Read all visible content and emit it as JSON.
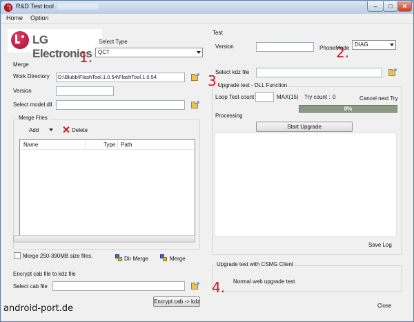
{
  "window": {
    "title": "R&D Test tool"
  },
  "menu": {
    "home": "Home",
    "option": "Option"
  },
  "logo": {
    "brand": "LG Electronics"
  },
  "select_type": {
    "label": "Select Type",
    "value": "QCT"
  },
  "merge": {
    "title": "Merge",
    "work_dir_label": "Work Directory",
    "work_dir_value": "D:\\Blubb\\FlashTool.1.0.54\\FlashTool.1.0.54",
    "version_label": "Version",
    "version_value": "",
    "model_dll_label": "Select model.dll",
    "model_dll_value": ""
  },
  "merge_files": {
    "title": "Merge Files",
    "add_label": "Add",
    "delete_label": "Delete",
    "columns": [
      "Name",
      "Type",
      "Path"
    ]
  },
  "merge_options": {
    "checkbox_label": "Merge 250-390MB size files.",
    "dir_merge_label": "Dir Merge",
    "merge_label": "Merge"
  },
  "encrypt": {
    "title": "Encrypt cab file to kdz file",
    "select_cab_label": "Select cab file",
    "select_cab_value": "",
    "button_label": "Encrypt cab -> kdz"
  },
  "test": {
    "title": "Test",
    "version_label": "Version",
    "version_value": "",
    "phone_mode_label": "PhoneMode",
    "phone_mode_value": "DIAG",
    "kdz_label": "Select kdz file",
    "kdz_value": ""
  },
  "upgrade_dll": {
    "title": "Upgrade test - DLL Function",
    "loop_label": "Loop Test count",
    "loop_value": "",
    "max_label": "MAX(15)",
    "try_count_label": "Try count :",
    "try_count_value": "0",
    "cancel_label": "Cancel next Try",
    "progress_text": "0%",
    "progress_percent": 0,
    "processing_label": "Processing",
    "start_label": "Start Upgrade",
    "save_log_label": "Save Log"
  },
  "csmg": {
    "title": "Upgrade test with CSMG Client",
    "normal_web_label": "Normal web upgrade test"
  },
  "footer": {
    "close_label": "Close"
  },
  "annotations": [
    "1.",
    "2.",
    "3.",
    "4."
  ],
  "watermark": "android-port.de",
  "colors": {
    "annotation": "#c8141e",
    "lg_brand": "#a40b3c"
  }
}
